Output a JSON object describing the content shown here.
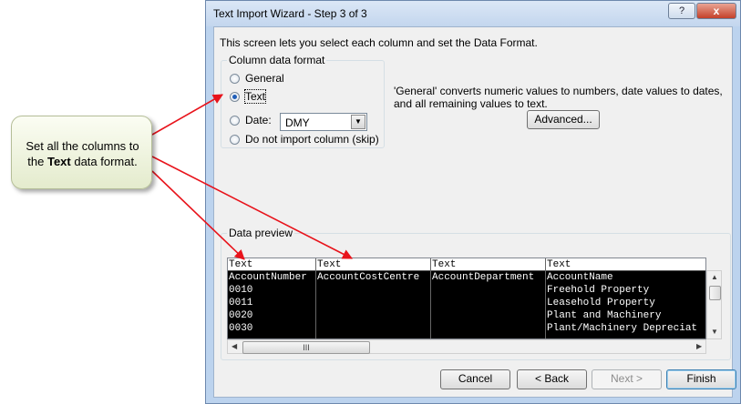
{
  "dialog": {
    "title": "Text Import Wizard - Step 3 of 3",
    "help_label": "?",
    "close_label": "x",
    "intro": "This screen lets you select each column and set the Data Format.",
    "column_format": {
      "title": "Column data format",
      "options": [
        {
          "label": "General",
          "selected": false
        },
        {
          "label": "Text",
          "selected": true
        },
        {
          "label": "Date:",
          "selected": false
        },
        {
          "label": "Do not import column (skip)",
          "selected": false
        }
      ],
      "date_value": "DMY"
    },
    "description": "'General' converts numeric values to numbers, date values to dates, and all remaining values to text.",
    "advanced_label": "Advanced...",
    "preview": {
      "title": "Data preview",
      "columns": [
        {
          "header": "Text",
          "cells": [
            "AccountNumber",
            "0010",
            "0011",
            "0020",
            "0030"
          ]
        },
        {
          "header": "Text",
          "cells": [
            "AccountCostCentre",
            "",
            "",
            "",
            ""
          ]
        },
        {
          "header": "Text",
          "cells": [
            "AccountDepartment",
            "",
            "",
            "",
            ""
          ]
        },
        {
          "header": "Text",
          "cells": [
            "AccountName",
            "Freehold Property",
            "Leasehold Property",
            "Plant and Machinery",
            "Plant/Machinery Depreciat"
          ]
        }
      ],
      "hscroll_grip": "III"
    },
    "buttons": {
      "cancel": "Cancel",
      "back": "< Back",
      "next": "Next >",
      "finish": "Finish"
    }
  },
  "callout": {
    "line1": "Set all the columns to",
    "line2_pre": "the ",
    "line2_bold": "Text",
    "line2_post": " data format."
  },
  "colors": {
    "arrow": "#e8131b",
    "selection": "#000000",
    "window_frame": "#bcd3ee"
  }
}
